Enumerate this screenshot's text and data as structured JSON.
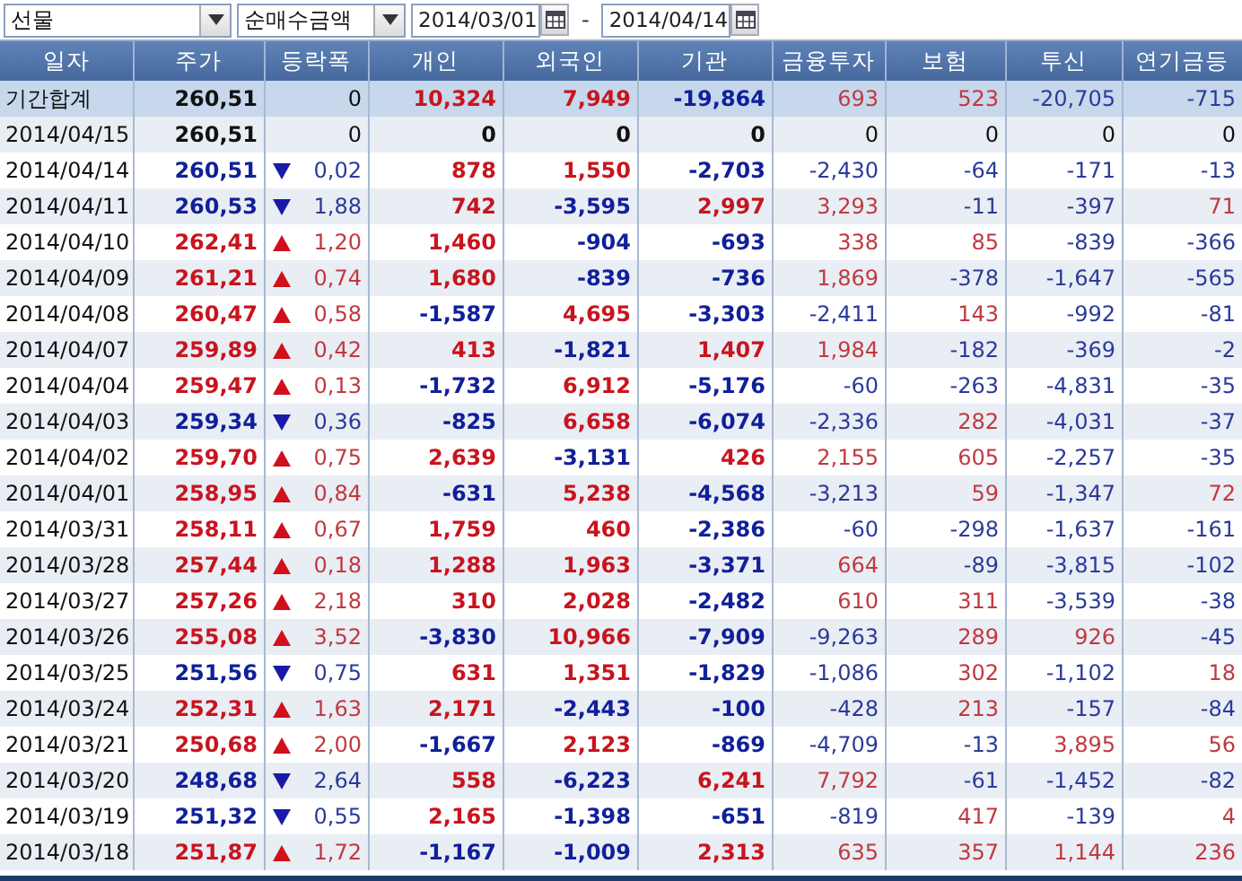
{
  "toolbar": {
    "market": {
      "value": "선물"
    },
    "measure": {
      "value": "순매수금액"
    },
    "start_date": {
      "value": "2014/03/01"
    },
    "separator": "-",
    "end_date": {
      "value": "2014/04/14"
    }
  },
  "table": {
    "columns": [
      {
        "label": "일자"
      },
      {
        "label": "주가"
      },
      {
        "label": "등락폭"
      },
      {
        "label": "개인"
      },
      {
        "label": "외국인"
      },
      {
        "label": "기관"
      },
      {
        "label": "금융투자"
      },
      {
        "label": "보험"
      },
      {
        "label": "투신"
      },
      {
        "label": "연기금등"
      }
    ],
    "rows": [
      {
        "kind": "summary",
        "cells": [
          {
            "text": "기간합계"
          },
          {
            "text": "260,51",
            "color": "#111111"
          },
          {
            "text": "0",
            "kind": "flat",
            "color": "#111111"
          },
          {
            "text": "10,324",
            "color": "#c8141e"
          },
          {
            "text": "7,949",
            "color": "#c8141e"
          },
          {
            "text": "-19,864",
            "color": "#10209a"
          },
          {
            "text": "693",
            "color": "#c0393f"
          },
          {
            "text": "523",
            "color": "#c0393f"
          },
          {
            "text": "-20,705",
            "color": "#2a3a9a"
          },
          {
            "text": "-715",
            "color": "#2a3a9a"
          }
        ]
      },
      {
        "kind": "day",
        "cells": [
          {
            "text": "2014/04/15"
          },
          {
            "text": "260,51",
            "color": "#111111"
          },
          {
            "text": "0",
            "kind": "flat",
            "color": "#111111"
          },
          {
            "text": "0",
            "color": "#111111"
          },
          {
            "text": "0",
            "color": "#111111"
          },
          {
            "text": "0",
            "color": "#111111"
          },
          {
            "text": "0",
            "color": "#111111"
          },
          {
            "text": "0",
            "color": "#111111"
          },
          {
            "text": "0",
            "color": "#111111"
          },
          {
            "text": "0",
            "color": "#111111"
          }
        ]
      },
      {
        "kind": "day",
        "cells": [
          {
            "text": "2014/04/14"
          },
          {
            "text": "260,51",
            "color": "#10209a"
          },
          {
            "text": "0,02",
            "kind": "fall",
            "color": "#2a3a9a"
          },
          {
            "text": "878",
            "color": "#c8141e"
          },
          {
            "text": "1,550",
            "color": "#c8141e"
          },
          {
            "text": "-2,703",
            "color": "#10209a"
          },
          {
            "text": "-2,430",
            "color": "#2a3a9a"
          },
          {
            "text": "-64",
            "color": "#2a3a9a"
          },
          {
            "text": "-171",
            "color": "#2a3a9a"
          },
          {
            "text": "-13",
            "color": "#2a3a9a"
          }
        ]
      },
      {
        "kind": "day",
        "cells": [
          {
            "text": "2014/04/11"
          },
          {
            "text": "260,53",
            "color": "#10209a"
          },
          {
            "text": "1,88",
            "kind": "fall",
            "color": "#2a3a9a"
          },
          {
            "text": "742",
            "color": "#c8141e"
          },
          {
            "text": "-3,595",
            "color": "#10209a"
          },
          {
            "text": "2,997",
            "color": "#c8141e"
          },
          {
            "text": "3,293",
            "color": "#c0393f"
          },
          {
            "text": "-11",
            "color": "#2a3a9a"
          },
          {
            "text": "-397",
            "color": "#2a3a9a"
          },
          {
            "text": "71",
            "color": "#c0393f"
          }
        ]
      },
      {
        "kind": "day",
        "cells": [
          {
            "text": "2014/04/10"
          },
          {
            "text": "262,41",
            "color": "#c8141e"
          },
          {
            "text": "1,20",
            "kind": "rise",
            "color": "#c0393f"
          },
          {
            "text": "1,460",
            "color": "#c8141e"
          },
          {
            "text": "-904",
            "color": "#10209a"
          },
          {
            "text": "-693",
            "color": "#10209a"
          },
          {
            "text": "338",
            "color": "#c0393f"
          },
          {
            "text": "85",
            "color": "#c0393f"
          },
          {
            "text": "-839",
            "color": "#2a3a9a"
          },
          {
            "text": "-366",
            "color": "#2a3a9a"
          }
        ]
      },
      {
        "kind": "day",
        "cells": [
          {
            "text": "2014/04/09"
          },
          {
            "text": "261,21",
            "color": "#c8141e"
          },
          {
            "text": "0,74",
            "kind": "rise",
            "color": "#c0393f"
          },
          {
            "text": "1,680",
            "color": "#c8141e"
          },
          {
            "text": "-839",
            "color": "#10209a"
          },
          {
            "text": "-736",
            "color": "#10209a"
          },
          {
            "text": "1,869",
            "color": "#c0393f"
          },
          {
            "text": "-378",
            "color": "#2a3a9a"
          },
          {
            "text": "-1,647",
            "color": "#2a3a9a"
          },
          {
            "text": "-565",
            "color": "#2a3a9a"
          }
        ]
      },
      {
        "kind": "day",
        "cells": [
          {
            "text": "2014/04/08"
          },
          {
            "text": "260,47",
            "color": "#c8141e"
          },
          {
            "text": "0,58",
            "kind": "rise",
            "color": "#c0393f"
          },
          {
            "text": "-1,587",
            "color": "#10209a"
          },
          {
            "text": "4,695",
            "color": "#c8141e"
          },
          {
            "text": "-3,303",
            "color": "#10209a"
          },
          {
            "text": "-2,411",
            "color": "#2a3a9a"
          },
          {
            "text": "143",
            "color": "#c0393f"
          },
          {
            "text": "-992",
            "color": "#2a3a9a"
          },
          {
            "text": "-81",
            "color": "#2a3a9a"
          }
        ]
      },
      {
        "kind": "day",
        "cells": [
          {
            "text": "2014/04/07"
          },
          {
            "text": "259,89",
            "color": "#c8141e"
          },
          {
            "text": "0,42",
            "kind": "rise",
            "color": "#c0393f"
          },
          {
            "text": "413",
            "color": "#c8141e"
          },
          {
            "text": "-1,821",
            "color": "#10209a"
          },
          {
            "text": "1,407",
            "color": "#c8141e"
          },
          {
            "text": "1,984",
            "color": "#c0393f"
          },
          {
            "text": "-182",
            "color": "#2a3a9a"
          },
          {
            "text": "-369",
            "color": "#2a3a9a"
          },
          {
            "text": "-2",
            "color": "#2a3a9a"
          }
        ]
      },
      {
        "kind": "day",
        "cells": [
          {
            "text": "2014/04/04"
          },
          {
            "text": "259,47",
            "color": "#c8141e"
          },
          {
            "text": "0,13",
            "kind": "rise",
            "color": "#c0393f"
          },
          {
            "text": "-1,732",
            "color": "#10209a"
          },
          {
            "text": "6,912",
            "color": "#c8141e"
          },
          {
            "text": "-5,176",
            "color": "#10209a"
          },
          {
            "text": "-60",
            "color": "#2a3a9a"
          },
          {
            "text": "-263",
            "color": "#2a3a9a"
          },
          {
            "text": "-4,831",
            "color": "#2a3a9a"
          },
          {
            "text": "-35",
            "color": "#2a3a9a"
          }
        ]
      },
      {
        "kind": "day",
        "cells": [
          {
            "text": "2014/04/03"
          },
          {
            "text": "259,34",
            "color": "#10209a"
          },
          {
            "text": "0,36",
            "kind": "fall",
            "color": "#2a3a9a"
          },
          {
            "text": "-825",
            "color": "#10209a"
          },
          {
            "text": "6,658",
            "color": "#c8141e"
          },
          {
            "text": "-6,074",
            "color": "#10209a"
          },
          {
            "text": "-2,336",
            "color": "#2a3a9a"
          },
          {
            "text": "282",
            "color": "#c0393f"
          },
          {
            "text": "-4,031",
            "color": "#2a3a9a"
          },
          {
            "text": "-37",
            "color": "#2a3a9a"
          }
        ]
      },
      {
        "kind": "day",
        "cells": [
          {
            "text": "2014/04/02"
          },
          {
            "text": "259,70",
            "color": "#c8141e"
          },
          {
            "text": "0,75",
            "kind": "rise",
            "color": "#c0393f"
          },
          {
            "text": "2,639",
            "color": "#c8141e"
          },
          {
            "text": "-3,131",
            "color": "#10209a"
          },
          {
            "text": "426",
            "color": "#c8141e"
          },
          {
            "text": "2,155",
            "color": "#c0393f"
          },
          {
            "text": "605",
            "color": "#c0393f"
          },
          {
            "text": "-2,257",
            "color": "#2a3a9a"
          },
          {
            "text": "-35",
            "color": "#2a3a9a"
          }
        ]
      },
      {
        "kind": "day",
        "cells": [
          {
            "text": "2014/04/01"
          },
          {
            "text": "258,95",
            "color": "#c8141e"
          },
          {
            "text": "0,84",
            "kind": "rise",
            "color": "#c0393f"
          },
          {
            "text": "-631",
            "color": "#10209a"
          },
          {
            "text": "5,238",
            "color": "#c8141e"
          },
          {
            "text": "-4,568",
            "color": "#10209a"
          },
          {
            "text": "-3,213",
            "color": "#2a3a9a"
          },
          {
            "text": "59",
            "color": "#c0393f"
          },
          {
            "text": "-1,347",
            "color": "#2a3a9a"
          },
          {
            "text": "72",
            "color": "#c0393f"
          }
        ]
      },
      {
        "kind": "day",
        "cells": [
          {
            "text": "2014/03/31"
          },
          {
            "text": "258,11",
            "color": "#c8141e"
          },
          {
            "text": "0,67",
            "kind": "rise",
            "color": "#c0393f"
          },
          {
            "text": "1,759",
            "color": "#c8141e"
          },
          {
            "text": "460",
            "color": "#c8141e"
          },
          {
            "text": "-2,386",
            "color": "#10209a"
          },
          {
            "text": "-60",
            "color": "#2a3a9a"
          },
          {
            "text": "-298",
            "color": "#2a3a9a"
          },
          {
            "text": "-1,637",
            "color": "#2a3a9a"
          },
          {
            "text": "-161",
            "color": "#2a3a9a"
          }
        ]
      },
      {
        "kind": "day",
        "cells": [
          {
            "text": "2014/03/28"
          },
          {
            "text": "257,44",
            "color": "#c8141e"
          },
          {
            "text": "0,18",
            "kind": "rise",
            "color": "#c0393f"
          },
          {
            "text": "1,288",
            "color": "#c8141e"
          },
          {
            "text": "1,963",
            "color": "#c8141e"
          },
          {
            "text": "-3,371",
            "color": "#10209a"
          },
          {
            "text": "664",
            "color": "#c0393f"
          },
          {
            "text": "-89",
            "color": "#2a3a9a"
          },
          {
            "text": "-3,815",
            "color": "#2a3a9a"
          },
          {
            "text": "-102",
            "color": "#2a3a9a"
          }
        ]
      },
      {
        "kind": "day",
        "cells": [
          {
            "text": "2014/03/27"
          },
          {
            "text": "257,26",
            "color": "#c8141e"
          },
          {
            "text": "2,18",
            "kind": "rise",
            "color": "#c0393f"
          },
          {
            "text": "310",
            "color": "#c8141e"
          },
          {
            "text": "2,028",
            "color": "#c8141e"
          },
          {
            "text": "-2,482",
            "color": "#10209a"
          },
          {
            "text": "610",
            "color": "#c0393f"
          },
          {
            "text": "311",
            "color": "#c0393f"
          },
          {
            "text": "-3,539",
            "color": "#2a3a9a"
          },
          {
            "text": "-38",
            "color": "#2a3a9a"
          }
        ]
      },
      {
        "kind": "day",
        "cells": [
          {
            "text": "2014/03/26"
          },
          {
            "text": "255,08",
            "color": "#c8141e"
          },
          {
            "text": "3,52",
            "kind": "rise",
            "color": "#c0393f"
          },
          {
            "text": "-3,830",
            "color": "#10209a"
          },
          {
            "text": "10,966",
            "color": "#c8141e"
          },
          {
            "text": "-7,909",
            "color": "#10209a"
          },
          {
            "text": "-9,263",
            "color": "#2a3a9a"
          },
          {
            "text": "289",
            "color": "#c0393f"
          },
          {
            "text": "926",
            "color": "#c0393f"
          },
          {
            "text": "-45",
            "color": "#2a3a9a"
          }
        ]
      },
      {
        "kind": "day",
        "cells": [
          {
            "text": "2014/03/25"
          },
          {
            "text": "251,56",
            "color": "#10209a"
          },
          {
            "text": "0,75",
            "kind": "fall",
            "color": "#2a3a9a"
          },
          {
            "text": "631",
            "color": "#c8141e"
          },
          {
            "text": "1,351",
            "color": "#c8141e"
          },
          {
            "text": "-1,829",
            "color": "#10209a"
          },
          {
            "text": "-1,086",
            "color": "#2a3a9a"
          },
          {
            "text": "302",
            "color": "#c0393f"
          },
          {
            "text": "-1,102",
            "color": "#2a3a9a"
          },
          {
            "text": "18",
            "color": "#c0393f"
          }
        ]
      },
      {
        "kind": "day",
        "cells": [
          {
            "text": "2014/03/24"
          },
          {
            "text": "252,31",
            "color": "#c8141e"
          },
          {
            "text": "1,63",
            "kind": "rise",
            "color": "#c0393f"
          },
          {
            "text": "2,171",
            "color": "#c8141e"
          },
          {
            "text": "-2,443",
            "color": "#10209a"
          },
          {
            "text": "-100",
            "color": "#10209a"
          },
          {
            "text": "-428",
            "color": "#2a3a9a"
          },
          {
            "text": "213",
            "color": "#c0393f"
          },
          {
            "text": "-157",
            "color": "#2a3a9a"
          },
          {
            "text": "-84",
            "color": "#2a3a9a"
          }
        ]
      },
      {
        "kind": "day",
        "cells": [
          {
            "text": "2014/03/21"
          },
          {
            "text": "250,68",
            "color": "#c8141e"
          },
          {
            "text": "2,00",
            "kind": "rise",
            "color": "#c0393f"
          },
          {
            "text": "-1,667",
            "color": "#10209a"
          },
          {
            "text": "2,123",
            "color": "#c8141e"
          },
          {
            "text": "-869",
            "color": "#10209a"
          },
          {
            "text": "-4,709",
            "color": "#2a3a9a"
          },
          {
            "text": "-13",
            "color": "#2a3a9a"
          },
          {
            "text": "3,895",
            "color": "#c0393f"
          },
          {
            "text": "56",
            "color": "#c0393f"
          }
        ]
      },
      {
        "kind": "day",
        "cells": [
          {
            "text": "2014/03/20"
          },
          {
            "text": "248,68",
            "color": "#10209a"
          },
          {
            "text": "2,64",
            "kind": "fall",
            "color": "#2a3a9a"
          },
          {
            "text": "558",
            "color": "#c8141e"
          },
          {
            "text": "-6,223",
            "color": "#10209a"
          },
          {
            "text": "6,241",
            "color": "#c8141e"
          },
          {
            "text": "7,792",
            "color": "#c0393f"
          },
          {
            "text": "-61",
            "color": "#2a3a9a"
          },
          {
            "text": "-1,452",
            "color": "#2a3a9a"
          },
          {
            "text": "-82",
            "color": "#2a3a9a"
          }
        ]
      },
      {
        "kind": "day",
        "cells": [
          {
            "text": "2014/03/19"
          },
          {
            "text": "251,32",
            "color": "#10209a"
          },
          {
            "text": "0,55",
            "kind": "fall",
            "color": "#2a3a9a"
          },
          {
            "text": "2,165",
            "color": "#c8141e"
          },
          {
            "text": "-1,398",
            "color": "#10209a"
          },
          {
            "text": "-651",
            "color": "#10209a"
          },
          {
            "text": "-819",
            "color": "#2a3a9a"
          },
          {
            "text": "417",
            "color": "#c0393f"
          },
          {
            "text": "-139",
            "color": "#2a3a9a"
          },
          {
            "text": "4",
            "color": "#c0393f"
          }
        ]
      },
      {
        "kind": "day",
        "cells": [
          {
            "text": "2014/03/18"
          },
          {
            "text": "251,87",
            "color": "#c8141e"
          },
          {
            "text": "1,72",
            "kind": "rise",
            "color": "#c0393f"
          },
          {
            "text": "-1,167",
            "color": "#10209a"
          },
          {
            "text": "-1,009",
            "color": "#10209a"
          },
          {
            "text": "2,313",
            "color": "#c8141e"
          },
          {
            "text": "635",
            "color": "#c0393f"
          },
          {
            "text": "357",
            "color": "#c0393f"
          },
          {
            "text": "1,144",
            "color": "#c0393f"
          },
          {
            "text": "236",
            "color": "#c0393f"
          }
        ]
      }
    ]
  }
}
